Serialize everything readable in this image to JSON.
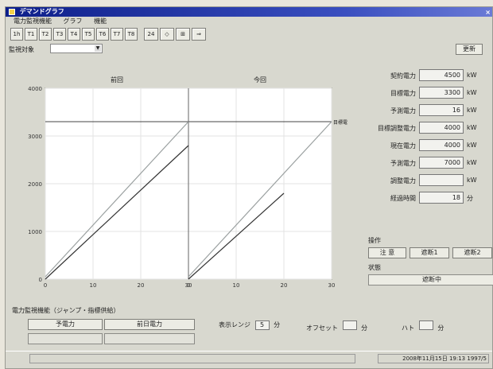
{
  "window": {
    "title": "デマンドグラフ",
    "close": "×"
  },
  "menu": [
    "電力監視機能",
    "グラフ",
    "機能"
  ],
  "toolbar": {
    "buttons": [
      "1h",
      "T1",
      "T2",
      "T3",
      "T4",
      "T5",
      "T6",
      "T7",
      "T8",
      "24",
      "◇",
      "⊞",
      "⇒"
    ]
  },
  "monitor": {
    "label": "監視対象",
    "value": "",
    "update_button": "更新"
  },
  "chart_data": {
    "type": "line",
    "left_panel_label": "前回",
    "right_panel_label": "今回",
    "target_label": "目標電力",
    "ylim": [
      0,
      4000
    ],
    "y_ticks": [
      "0",
      "1000",
      "2000",
      "3000",
      "4000"
    ],
    "target_value": 3300,
    "x_ticks_left": [
      "0",
      "10",
      "20",
      "30"
    ],
    "x_ticks_right": [
      "0",
      "10",
      "20",
      "30"
    ],
    "series": [
      {
        "values": [
          [
            0,
            50
          ],
          [
            30,
            3300
          ]
        ],
        "panel": "left",
        "color": "#9aa0a0"
      },
      {
        "values": [
          [
            0,
            0
          ],
          [
            30,
            2800
          ]
        ],
        "panel": "left",
        "color": "#333333"
      },
      {
        "values": [
          [
            0,
            50
          ],
          [
            30,
            3300
          ]
        ],
        "panel": "right",
        "color": "#9aa0a0"
      },
      {
        "values": [
          [
            0,
            0
          ],
          [
            20,
            1800
          ]
        ],
        "panel": "right",
        "color": "#333333"
      }
    ]
  },
  "params": [
    {
      "label": "契約電力",
      "value": "4500",
      "unit": "kW"
    },
    {
      "label": "目標電力",
      "value": "3300",
      "unit": "kW"
    },
    {
      "label": "予測電力",
      "value": "16",
      "unit": "kW"
    },
    {
      "label": "目標調整電力",
      "value": "4000",
      "unit": "kW"
    },
    {
      "label": "現在電力",
      "value": "4000",
      "unit": "kW"
    },
    {
      "label": "予測電力",
      "value": "7000",
      "unit": "kW"
    },
    {
      "label": "調整電力",
      "value": "",
      "unit": "kW"
    },
    {
      "label": "経過時間",
      "value": "18",
      "unit": "分"
    }
  ],
  "operation": {
    "label": "操作",
    "buttons": [
      "注 意",
      "遮断1",
      "遮断2"
    ],
    "status_label": "状態",
    "status_value": "遮断中"
  },
  "bottom": {
    "title": "電力監視機能（ジャンプ・指標供給）",
    "btn1": "予電力",
    "btn2": "前日電力",
    "ctrl1_label": "表示レンジ",
    "ctrl1_value": "5",
    "ctrl1_unit": "分",
    "ctrl2_label": "オフセット",
    "ctrl2_value": "",
    "ctrl2_unit": "分",
    "ctrl3_label": "ハト",
    "ctrl3_value": "",
    "ctrl3_unit": "分"
  },
  "statusbar": {
    "datetime": "2008年11月15日 19:13 1997/5"
  }
}
